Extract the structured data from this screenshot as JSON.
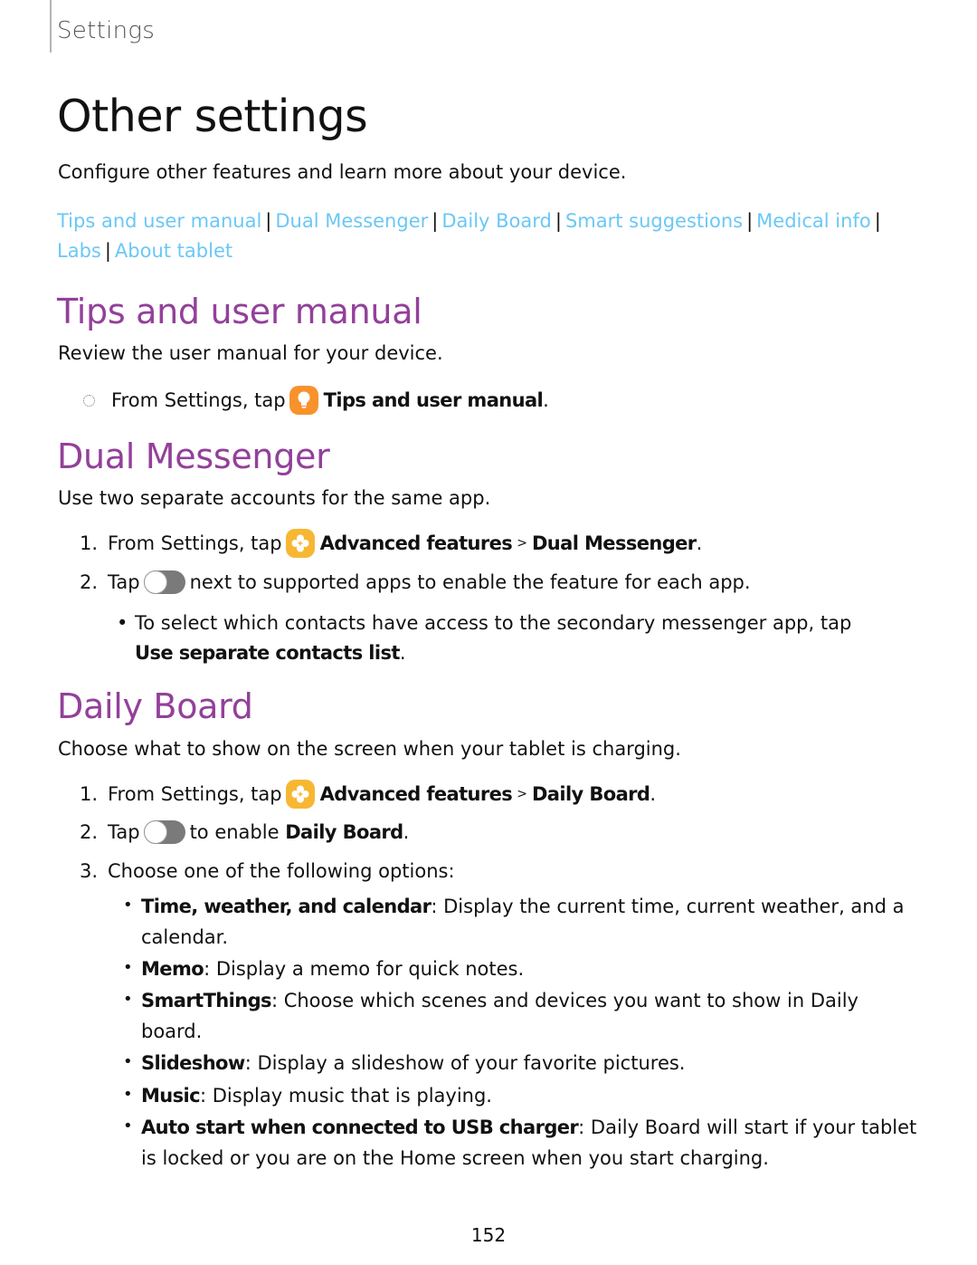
{
  "header": {
    "section_label": "Settings"
  },
  "page": {
    "title": "Other settings",
    "intro": "Configure other features and learn more about your device.",
    "page_number": "152"
  },
  "colors": {
    "link": "#6ac8f5",
    "heading": "#93409a",
    "tips_icon": "#f7922d",
    "advanced_icon": "#f7b733",
    "toggle": "#7a7a7a"
  },
  "links": [
    "Tips and user manual",
    "Dual Messenger",
    "Daily Board",
    "Smart suggestions",
    "Medical info",
    "Labs",
    "About tablet"
  ],
  "link_separator": "|",
  "tips": {
    "heading": "Tips and user manual",
    "description": "Review the user manual for your device.",
    "step": {
      "prefix": "From Settings, tap",
      "icon": "lightbulb-icon",
      "target": "Tips and user manual",
      "suffix": "."
    }
  },
  "dual": {
    "heading": "Dual Messenger",
    "description": "Use two separate accounts for the same app.",
    "steps": [
      {
        "num": "1.",
        "prefix": "From Settings, tap",
        "icon": "advanced-features-icon",
        "target": "Advanced features",
        "arrow": ">",
        "target2": "Dual Messenger",
        "suffix": "."
      },
      {
        "num": "2.",
        "prefix": "Tap",
        "icon": "toggle-switch",
        "text": "next to supported apps to enable the feature for each app."
      }
    ],
    "sub_bullet": {
      "dot": "•",
      "text": "To select which contacts have access to the secondary messenger app, tap",
      "bold": "Use separate contacts list",
      "suffix": "."
    }
  },
  "daily": {
    "heading": "Daily Board",
    "description": "Choose what to show on the screen when your tablet is charging.",
    "steps": [
      {
        "num": "1.",
        "prefix": "From Settings, tap",
        "icon": "advanced-features-icon",
        "target": "Advanced features",
        "arrow": ">",
        "target2": "Daily Board",
        "suffix": "."
      },
      {
        "num": "2.",
        "prefix": "Tap",
        "icon": "toggle-switch",
        "text": "to enable",
        "bold": "Daily Board",
        "suffix": "."
      },
      {
        "num": "3.",
        "text": "Choose one of the following options:"
      }
    ],
    "options": [
      {
        "dot": "•",
        "label": "Time, weather, and calendar",
        "text": ": Display the current time, current weather, and a calendar."
      },
      {
        "dot": "•",
        "label": "Memo",
        "text": ": Display a memo for quick notes."
      },
      {
        "dot": "•",
        "label": "SmartThings",
        "text": ": Choose which scenes and devices you want to show in Daily board."
      },
      {
        "dot": "•",
        "label": "Slideshow",
        "text": ": Display a slideshow of your favorite pictures."
      },
      {
        "dot": "•",
        "label": "Music",
        "text": ": Display music that is playing."
      },
      {
        "dot": "•",
        "label": "Auto start when connected to USB charger",
        "text": ": Daily Board will start if your tablet is locked or you are on the Home screen when you start charging."
      }
    ]
  }
}
